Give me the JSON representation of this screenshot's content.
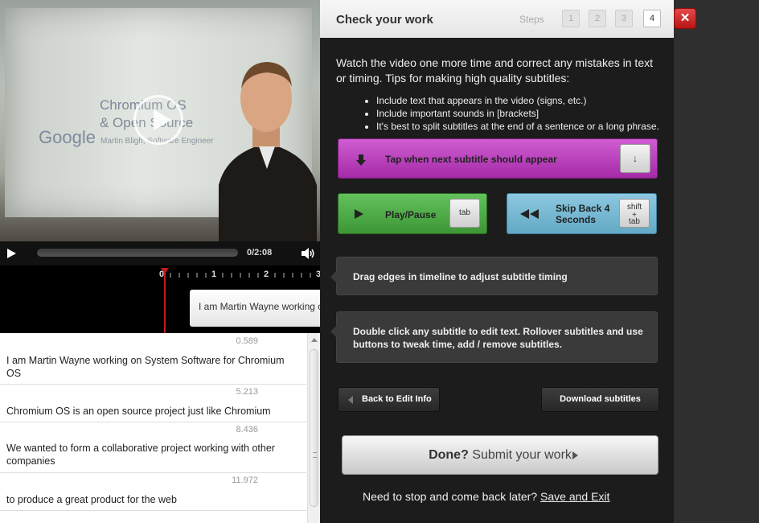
{
  "video": {
    "slide_logo": "Google",
    "slide_title": "Chromium OS\n& Open Source",
    "slide_subtitle": "Martin Bligh, Software Engineer",
    "time_display": "0/2:08"
  },
  "timeline": {
    "ticks": [
      "0",
      "1",
      "2",
      "3"
    ],
    "current_subtitle": "I am Martin Wayne working on System Software for Chromium OS"
  },
  "subtitles": [
    {
      "time": "0.589",
      "text": "I am Martin Wayne working on System Software for Chromium OS"
    },
    {
      "time": "5.213",
      "text": "Chromium OS is an open source project just like Chromium"
    },
    {
      "time": "8.436",
      "text": "We wanted to form a collaborative project working with other companies"
    },
    {
      "time": "11.972",
      "text": "to produce a great product for the web"
    }
  ],
  "dialog": {
    "title": "Check your work",
    "steps_label": "Steps",
    "steps": [
      "1",
      "2",
      "3",
      "4"
    ],
    "active_step": "4",
    "close_label": "✕",
    "intro": "Watch the video one more time and correct any mistakes in text or timing. Tips for making high quality subtitles:",
    "tips": [
      "Include text that appears in the video (signs, etc.)",
      "Include important sounds in [brackets]",
      "It's best to split subtitles at the end of a sentence or a long phrase."
    ],
    "next_subtitle_label": "Tap when next subtitle should appear",
    "next_subtitle_key": "↓",
    "play_pause_label": "Play/Pause",
    "play_pause_key": "tab",
    "skip_back_label": "Skip Back 4 Seconds",
    "skip_back_key_line1": "shift",
    "skip_back_key_line2": "+",
    "skip_back_key_line3": "tab",
    "info_timing": "Drag edges in timeline to adjust subtitle timing",
    "info_edit": "Double click any subtitle to edit text. Rollover subtitles and use buttons to tweak time, add / remove subtitles.",
    "back_label": "Back to Edit Info",
    "download_label": "Download subtitles",
    "done_bold": "Done?",
    "done_rest": " Submit your work",
    "later_text": "Need to stop and come back later? ",
    "save_exit": "Save and Exit"
  },
  "colors": {
    "next_button": "#b93bbc",
    "play_button": "#4caa45",
    "skip_button": "#78b9d3",
    "close_button": "#cc2020",
    "playhead": "#c41c1c"
  }
}
